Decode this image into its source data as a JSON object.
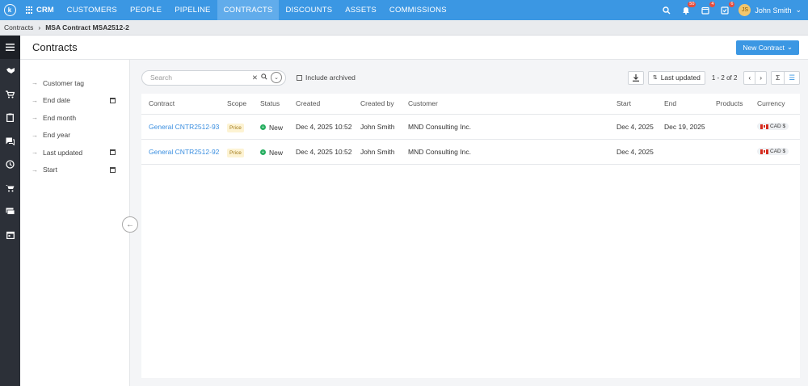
{
  "nav": {
    "logo": "k",
    "apps_label": "CRM",
    "items": [
      "CUSTOMERS",
      "PEOPLE",
      "PIPELINE",
      "CONTRACTS",
      "DISCOUNTS",
      "ASSETS",
      "COMMISSIONS"
    ],
    "active": "CONTRACTS",
    "badges": {
      "notifications": "50",
      "tasks": "4",
      "approvals": "6"
    },
    "user_initials": "JS",
    "user_name": "John Smith"
  },
  "breadcrumb": {
    "parent": "Contracts",
    "current": "MSA Contract MSA2512-2"
  },
  "header": {
    "title": "Contracts",
    "new_button": "New Contract"
  },
  "filters": [
    {
      "label": "Customer tag",
      "calendar": false
    },
    {
      "label": "End date",
      "calendar": true
    },
    {
      "label": "End month",
      "calendar": false
    },
    {
      "label": "End year",
      "calendar": false
    },
    {
      "label": "Last updated",
      "calendar": true
    },
    {
      "label": "Start",
      "calendar": true
    }
  ],
  "toolbar": {
    "search_placeholder": "Search",
    "include_archived": "Include archived",
    "sort_label": "Last updated",
    "paging": "1 - 2 of 2"
  },
  "table": {
    "columns": [
      "Contract",
      "Scope",
      "Status",
      "Created",
      "Created by",
      "Customer",
      "Start",
      "End",
      "Products",
      "Currency"
    ],
    "rows": [
      {
        "contract": "General CNTR2512-93",
        "scope": "Price",
        "status": "New",
        "created": "Dec 4, 2025 10:52",
        "created_by": "John Smith",
        "customer": "MND Consulting Inc.",
        "start": "Dec 4, 2025",
        "end": "Dec 19, 2025",
        "products": "",
        "currency": "CAD $"
      },
      {
        "contract": "General CNTR2512-92",
        "scope": "Price",
        "status": "New",
        "created": "Dec 4, 2025 10:52",
        "created_by": "John Smith",
        "customer": "MND Consulting Inc.",
        "start": "Dec 4, 2025",
        "end": "",
        "products": "",
        "currency": "CAD $"
      }
    ]
  },
  "colors": {
    "primary": "#3b97e3",
    "rail": "#2c3038",
    "status_new": "#27ae60"
  }
}
